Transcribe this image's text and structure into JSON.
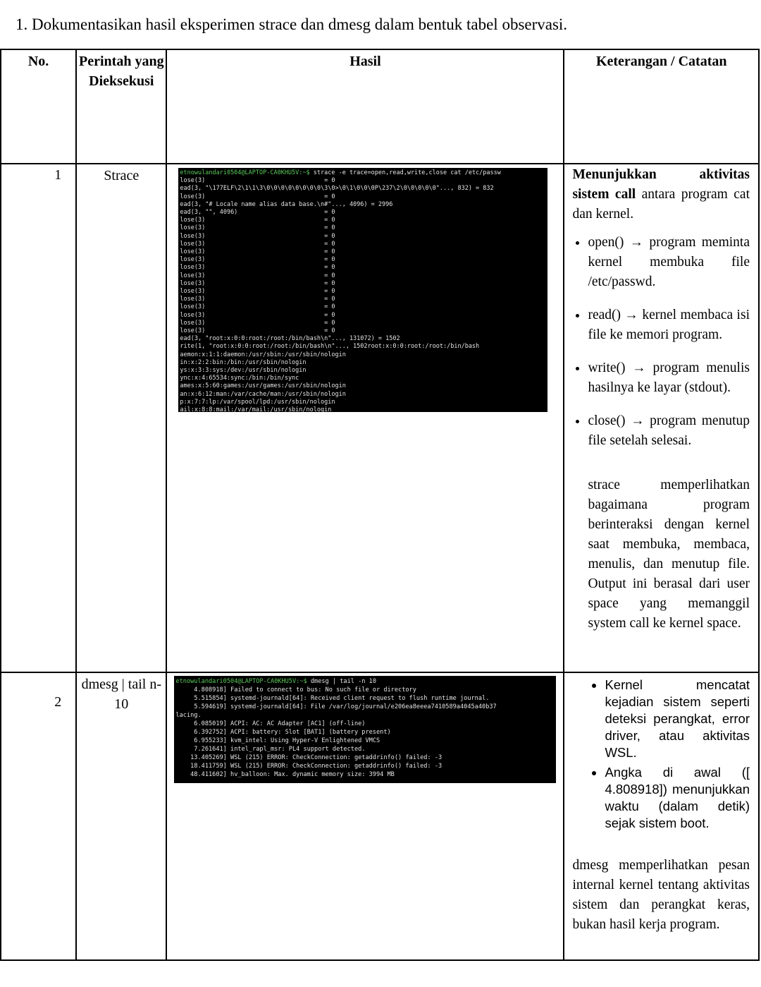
{
  "heading": "1. Dokumentasikan hasil eksperimen strace dan dmesg dalam bentuk tabel observasi.",
  "table": {
    "headers": {
      "no": "No.",
      "command": "Perintah yang Dieksekusi",
      "result": "Hasil",
      "notes": "Keterangan / Catatan"
    },
    "rows": [
      {
        "no": "1",
        "command": "Strace",
        "terminal_lines": [
          "etnowulandari0504@LAPTOP-CA0KHU5V:~$ strace -e trace=open,read,write,close cat /etc/passw",
          "lose(3)                                 = 0",
          "ead(3, \"\\177ELF\\2\\1\\1\\3\\0\\0\\0\\0\\0\\0\\0\\0\\3\\0>\\0\\1\\0\\0\\0P\\237\\2\\0\\0\\0\\0\\0\"..., 832) = 832",
          "lose(3)                                 = 0",
          "ead(3, \"# Locale name alias data base.\\n#\"..., 4096) = 2996",
          "ead(3, \"\", 4096)                        = 0",
          "lose(3)                                 = 0",
          "lose(3)                                 = 0",
          "lose(3)                                 = 0",
          "lose(3)                                 = 0",
          "lose(3)                                 = 0",
          "lose(3)                                 = 0",
          "lose(3)                                 = 0",
          "lose(3)                                 = 0",
          "lose(3)                                 = 0",
          "lose(3)                                 = 0",
          "lose(3)                                 = 0",
          "lose(3)                                 = 0",
          "lose(3)                                 = 0",
          "lose(3)                                 = 0",
          "lose(3)                                 = 0",
          "ead(3, \"root:x:0:0:root:/root:/bin/bash\\n\"..., 131072) = 1502",
          "rite(1, \"root:x:0:0:root:/root:/bin/bash\\n\"..., 1502root:x:0:0:root:/root:/bin/bash",
          "aemon:x:1:1:daemon:/usr/sbin:/usr/sbin/nologin",
          "in:x:2:2:bin:/bin:/usr/sbin/nologin",
          "ys:x:3:3:sys:/dev:/usr/sbin/nologin",
          "ync:x:4:65534:sync:/bin:/bin/sync",
          "ames:x:5:60:games:/usr/games:/usr/sbin/nologin",
          "an:x:6:12:man:/var/cache/man:/usr/sbin/nologin",
          "p:x:7:7:lp:/var/spool/lpd:/usr/sbin/nologin",
          "ail:x:8:8:mail:/var/mail:/usr/sbin/nologin"
        ],
        "notes": {
          "intro_bold": "Menunjukkan aktivitas sistem call",
          "intro_rest": " antara program cat dan kernel.",
          "bullets": [
            "open() → program meminta kernel membuka file /etc/passwd.",
            "read() → kernel membaca isi file ke memori program.",
            "write() → program menulis hasilnya ke layar (stdout).",
            "close() → program menutup file setelah selesai."
          ],
          "summary": "strace memperlihatkan bagaimana program berinteraksi dengan kernel saat membuka, membaca, menulis, dan menutup file. Output ini berasal dari user space yang memanggil system call ke kernel space."
        }
      },
      {
        "no": "2",
        "command": "dmesg | tail n-10",
        "terminal_lines": [
          "etnowulandari0504@LAPTOP-CA0KHU5V:~$ dmesg | tail -n 10",
          "     4.808918] Failed to connect to bus: No such file or directory",
          "     5.515854] systemd-journald[64]: Received client request to flush runtime journal.",
          "     5.594619] systemd-journald[64]: File /var/log/journal/e206ea8eeea7410589a4045a40b37",
          "lacing.",
          "     6.085019] ACPI: AC: AC Adapter [AC1] (off-line)",
          "     6.392752] ACPI: battery: Slot [BAT1] (battery present)",
          "     6.955233] kvm_intel: Using Hyper-V Enlightened VMCS",
          "     7.261641] intel_rapl_msr: PL4 support detected.",
          "    13.405269] WSL (215) ERROR: CheckConnection: getaddrinfo() failed: -3",
          "    18.411759] WSL (215) ERROR: CheckConnection: getaddrinfo() failed: -3",
          "    48.411602] hv_balloon: Max. dynamic memory size: 3994 MB"
        ],
        "notes": {
          "bullets": [
            "Kernel mencatat kejadian sistem seperti deteksi perangkat, error driver, atau aktivitas WSL.",
            "Angka di awal ([ 4.808918]) menunjukkan waktu (dalam detik) sejak sistem boot."
          ],
          "summary": "dmesg memperlihatkan pesan internal kernel tentang aktivitas sistem dan perangkat keras, bukan hasil kerja program."
        }
      }
    ]
  }
}
